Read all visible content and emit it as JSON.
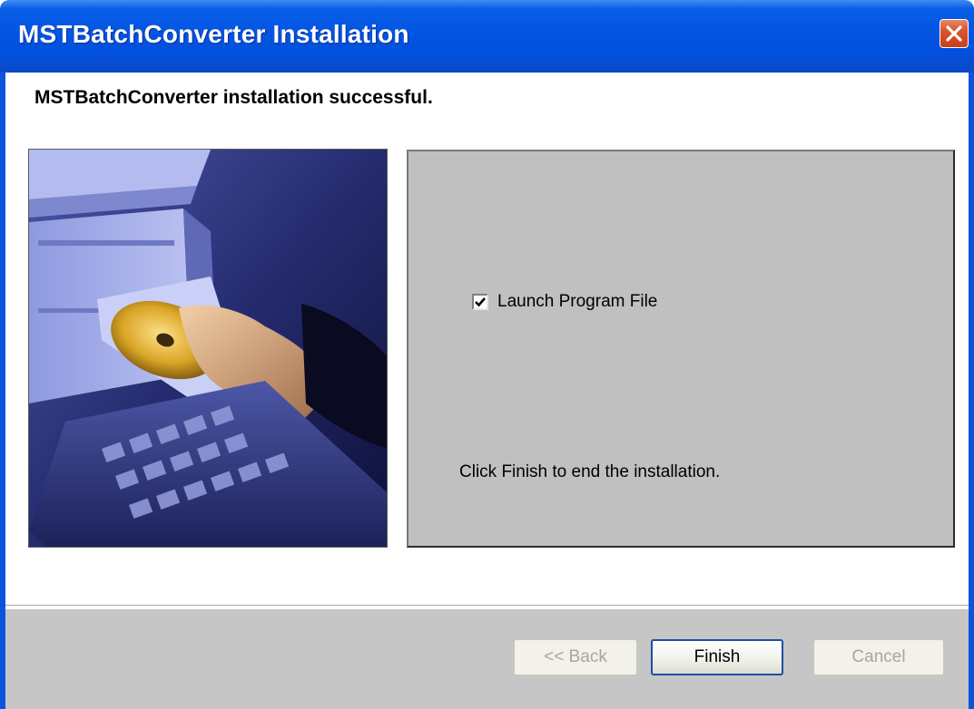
{
  "window": {
    "title": "MSTBatchConverter Installation"
  },
  "header": {
    "heading": "MSTBatchConverter installation successful."
  },
  "options": {
    "launch_label": "Launch Program File",
    "launch_checked": true
  },
  "panel": {
    "instruction": "Click Finish to end the installation."
  },
  "buttons": {
    "back": "<< Back",
    "finish": "Finish",
    "cancel": "Cancel"
  },
  "colors": {
    "titlebar": "#0355e3",
    "panel": "#c0c0c0",
    "footer": "#c6c6c6",
    "close": "#d9532e"
  },
  "icons": {
    "close": "close-icon",
    "check": "checkmark-icon"
  }
}
